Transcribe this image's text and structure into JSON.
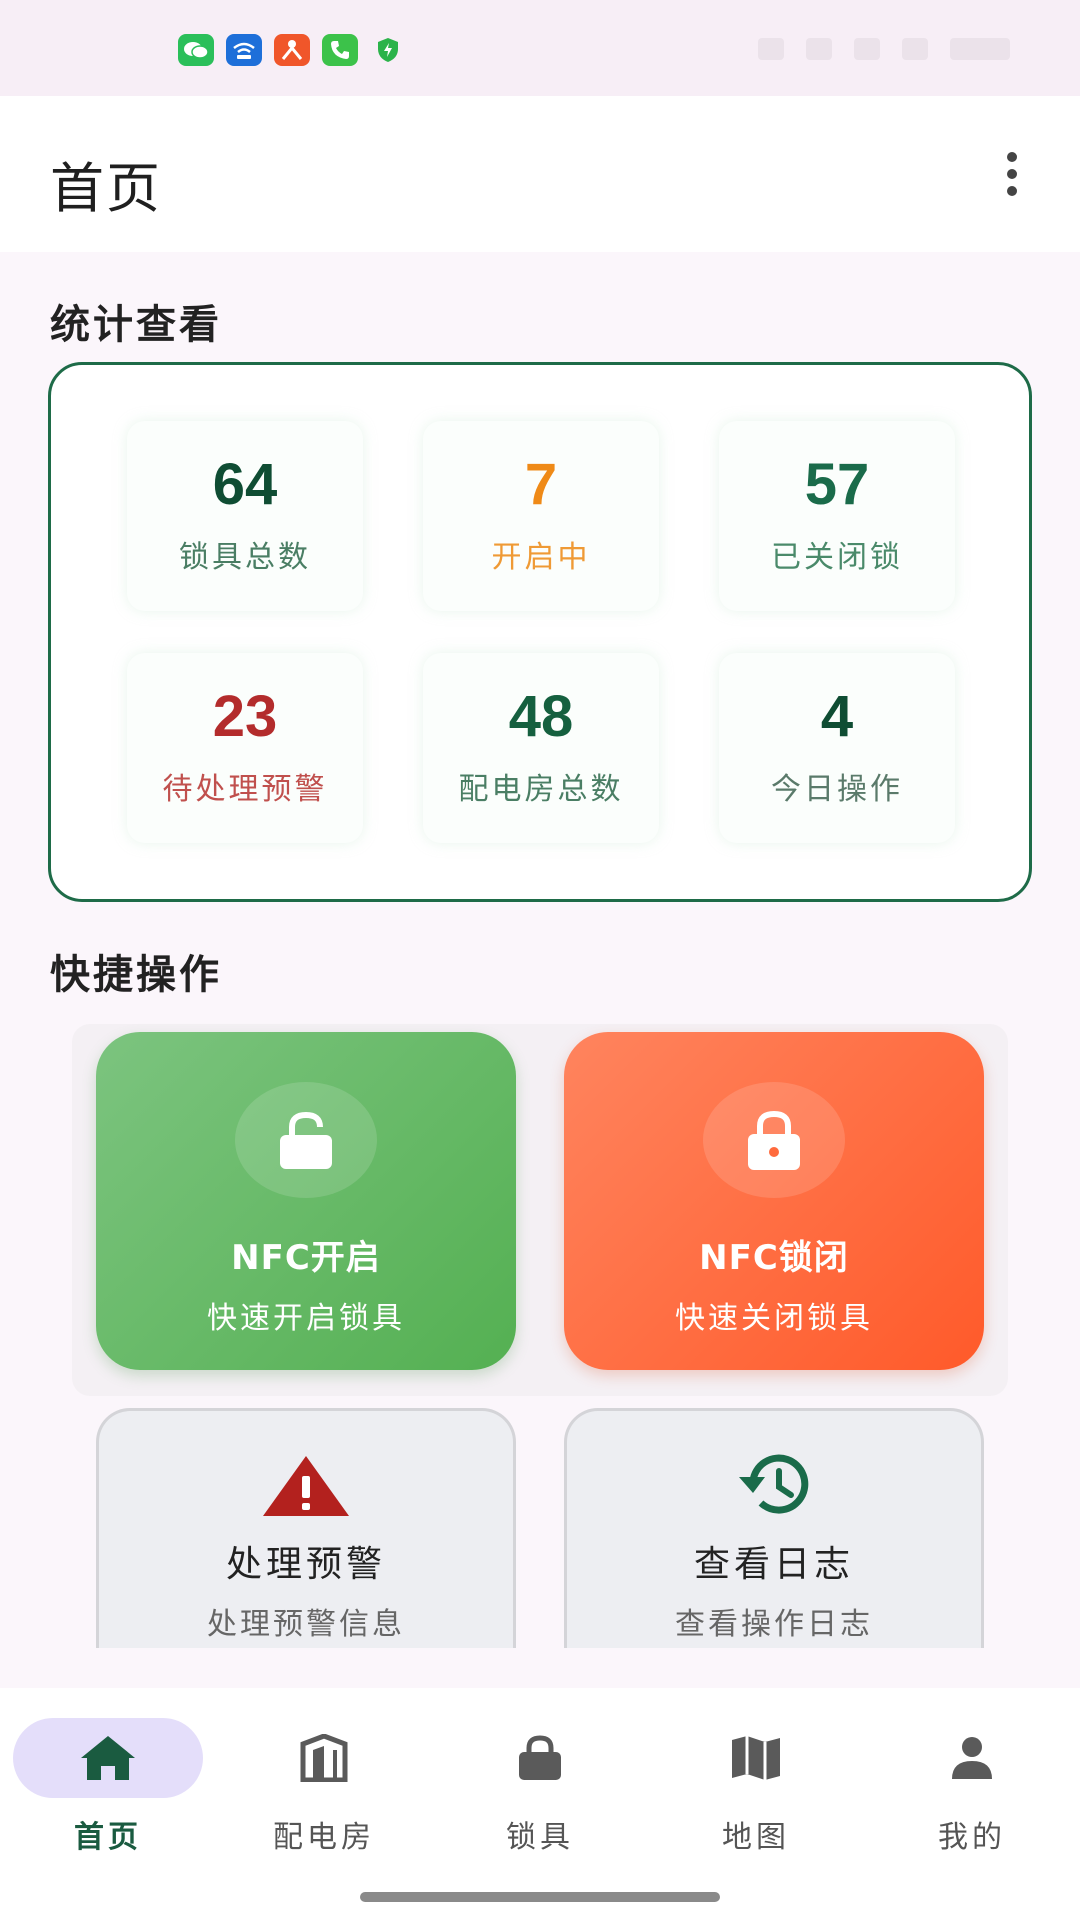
{
  "colors": {
    "primary": "#1a5b40",
    "accent_orange": "#ef8a17",
    "alert_red": "#b32c2c",
    "text_green": "#4a7e64",
    "nfc_open": "#5fb55c",
    "nfc_close": "#ff6a3d"
  },
  "header": {
    "title": "首页"
  },
  "stats": {
    "section_title": "统计查看",
    "items": [
      {
        "value": "64",
        "label": "锁具总数"
      },
      {
        "value": "7",
        "label": "开启中"
      },
      {
        "value": "57",
        "label": "已关闭锁"
      },
      {
        "value": "23",
        "label": "待处理预警"
      },
      {
        "value": "48",
        "label": "配电房总数"
      },
      {
        "value": "4",
        "label": "今日操作"
      }
    ]
  },
  "quick": {
    "section_title": "快捷操作",
    "actions": [
      {
        "title": "NFC开启",
        "subtitle": "快速开启锁具",
        "icon": "lock-open-icon"
      },
      {
        "title": "NFC锁闭",
        "subtitle": "快速关闭锁具",
        "icon": "lock-closed-icon"
      },
      {
        "title": "处理预警",
        "subtitle": "处理预警信息",
        "icon": "warning-icon"
      },
      {
        "title": "查看日志",
        "subtitle": "查看操作日志",
        "icon": "history-icon"
      }
    ]
  },
  "nav": {
    "items": [
      {
        "label": "首页",
        "icon": "home-icon",
        "active": true
      },
      {
        "label": "配电房",
        "icon": "substation-icon"
      },
      {
        "label": "锁具",
        "icon": "lock-icon"
      },
      {
        "label": "地图",
        "icon": "map-icon"
      },
      {
        "label": "我的",
        "icon": "person-icon"
      }
    ]
  }
}
